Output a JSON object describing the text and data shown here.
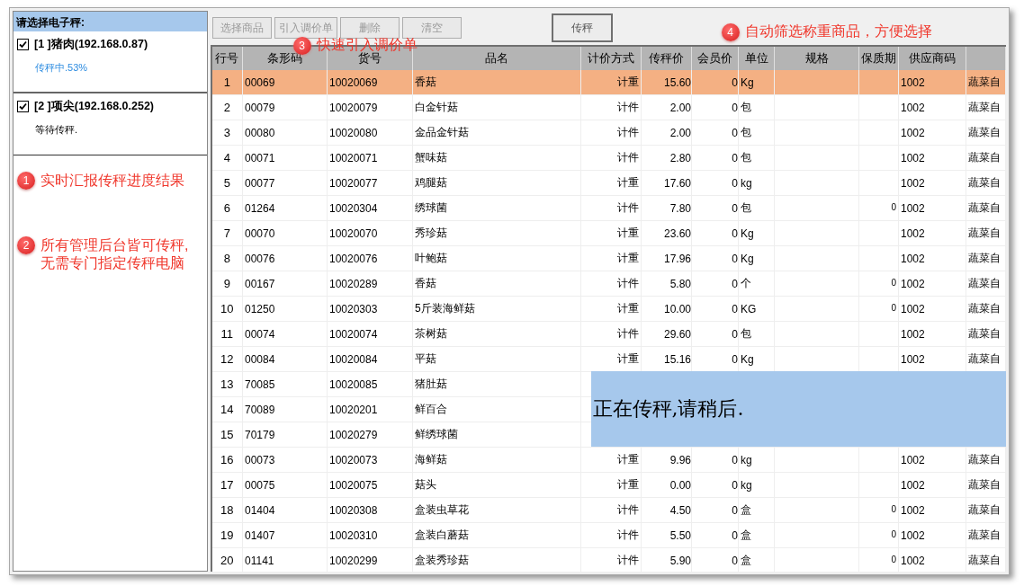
{
  "scale_panel": {
    "title": "请选择电子秤:",
    "scales": [
      {
        "label": "[1 ]猪肉(192.168.0.87)",
        "checked": true,
        "status": "传秤中.53%",
        "kind": "progress"
      },
      {
        "label": "[2 ]项尖(192.168.0.252)",
        "checked": true,
        "status": "等待传秤.",
        "kind": "waiting"
      }
    ]
  },
  "notes": [
    {
      "number": "1",
      "text": "实时汇报传秤进度结果"
    },
    {
      "number": "2",
      "text": "所有管理后台皆可传秤,\n无需专门指定传秤电脑"
    }
  ],
  "toolbar": {
    "buttons": [
      {
        "label": "选择商品",
        "disabled": true
      },
      {
        "label": "引入调价单",
        "disabled": true
      },
      {
        "label": "删除",
        "disabled": true
      },
      {
        "label": "清空",
        "disabled": true
      }
    ],
    "send_button": {
      "label": "传秤",
      "disabled": false
    }
  },
  "callouts": [
    {
      "number": "3",
      "text": "快速引入调价单"
    },
    {
      "number": "4",
      "text": "自动筛选称重商品，方便选择"
    }
  ],
  "table": {
    "columns": [
      "行号",
      "条形码",
      "货号",
      "品名",
      "计价方式",
      "传秤价",
      "会员价",
      "单位",
      "规格",
      "保质期",
      "供应商码"
    ],
    "rows": [
      {
        "no": "1",
        "barcode": "00069",
        "code": "10020069",
        "name": "香菇",
        "pricing": "计重",
        "price": "15.60",
        "member_price": "0",
        "unit": "Kg",
        "shelf_life": "",
        "supplier": "1002",
        "column_12": "蔬菜自",
        "selected": true
      },
      {
        "no": "2",
        "barcode": "00079",
        "code": "10020079",
        "name": "白金针菇",
        "pricing": "计件",
        "price": "2.00",
        "member_price": "0",
        "unit": "包",
        "supplier": "1002",
        "column_12": "蔬菜自",
        "selected": false
      },
      {
        "no": "3",
        "barcode": "00080",
        "code": "10020080",
        "name": "金品金针菇",
        "pricing": "计件",
        "price": "2.00",
        "member_price": "0",
        "unit": "包",
        "supplier": "1002",
        "column_12": "蔬菜自",
        "selected": false
      },
      {
        "no": "4",
        "barcode": "00071",
        "code": "10020071",
        "name": "蟹味菇",
        "pricing": "计件",
        "price": "2.80",
        "member_price": "0",
        "unit": "包",
        "supplier": "1002",
        "column_12": "蔬菜自",
        "selected": false
      },
      {
        "no": "5",
        "barcode": "00077",
        "code": "10020077",
        "name": "鸡腿菇",
        "pricing": "计重",
        "price": "17.60",
        "member_price": "0",
        "unit": "kg",
        "supplier": "1002",
        "column_12": "蔬菜自",
        "selected": false
      },
      {
        "no": "6",
        "barcode": "01264",
        "code": "10020304",
        "name": "绣球菌",
        "pricing": "计件",
        "price": "7.80",
        "member_price": "0",
        "unit": "包",
        "shelf_life": "0",
        "supplier": "1002",
        "column_12": "蔬菜自",
        "selected": false
      },
      {
        "no": "7",
        "barcode": "00070",
        "code": "10020070",
        "name": "秀珍菇",
        "pricing": "计重",
        "price": "23.60",
        "member_price": "0",
        "unit": "Kg",
        "supplier": "1002",
        "column_12": "蔬菜自",
        "selected": false
      },
      {
        "no": "8",
        "barcode": "00076",
        "code": "10020076",
        "name": "叶鲍菇",
        "pricing": "计重",
        "price": "17.96",
        "member_price": "0",
        "unit": "Kg",
        "supplier": "1002",
        "column_12": "蔬菜自",
        "selected": false
      },
      {
        "no": "9",
        "barcode": "00167",
        "code": "10020289",
        "name": "香菇",
        "pricing": "计件",
        "price": "5.80",
        "member_price": "0",
        "unit": "个",
        "shelf_life": "0",
        "supplier": "1002",
        "column_12": "蔬菜自",
        "selected": false
      },
      {
        "no": "10",
        "barcode": "01250",
        "code": "10020303",
        "name": "5斤装海鲜菇",
        "pricing": "计重",
        "price": "10.00",
        "member_price": "0",
        "unit": "KG",
        "shelf_life": "0",
        "supplier": "1002",
        "column_12": "蔬菜自",
        "selected": false
      },
      {
        "no": "11",
        "barcode": "00074",
        "code": "10020074",
        "name": "茶树菇",
        "pricing": "计件",
        "price": "29.60",
        "member_price": "0",
        "unit": "包",
        "supplier": "1002",
        "column_12": "蔬菜自",
        "selected": false
      },
      {
        "no": "12",
        "barcode": "00084",
        "code": "10020084",
        "name": "平菇",
        "pricing": "计重",
        "price": "15.16",
        "member_price": "0",
        "unit": "Kg",
        "supplier": "1002",
        "column_12": "蔬菜自",
        "selected": false
      },
      {
        "no": "13",
        "barcode": "70085",
        "code": "10020085",
        "name": "猪肚菇",
        "selected": false
      },
      {
        "no": "14",
        "barcode": "70089",
        "code": "10020201",
        "name": "鲜百合",
        "selected": false
      },
      {
        "no": "15",
        "barcode": "70179",
        "code": "10020279",
        "name": "鲜绣球菌",
        "selected": false
      },
      {
        "no": "16",
        "barcode": "00073",
        "code": "10020073",
        "name": "海鲜菇",
        "pricing": "计重",
        "price": "9.96",
        "member_price": "0",
        "unit": "kg",
        "supplier": "1002",
        "column_12": "蔬菜自",
        "selected": false
      },
      {
        "no": "17",
        "barcode": "00075",
        "code": "10020075",
        "name": "菇头",
        "pricing": "计重",
        "price": "0.00",
        "member_price": "0",
        "unit": "kg",
        "supplier": "1002",
        "column_12": "蔬菜自",
        "selected": false
      },
      {
        "no": "18",
        "barcode": "01404",
        "code": "10020308",
        "name": "盒装虫草花",
        "pricing": "计件",
        "price": "4.50",
        "member_price": "0",
        "unit": "盒",
        "shelf_life": "0",
        "supplier": "1002",
        "column_12": "蔬菜自",
        "selected": false
      },
      {
        "no": "19",
        "barcode": "01407",
        "code": "10020310",
        "name": "盒装白蘑菇",
        "pricing": "计件",
        "price": "5.50",
        "member_price": "0",
        "unit": "盒",
        "shelf_life": "0",
        "supplier": "1002",
        "column_12": "蔬菜自",
        "selected": false
      },
      {
        "no": "20",
        "barcode": "01141",
        "code": "10020299",
        "name": "盒装秀珍菇",
        "pricing": "计件",
        "price": "5.90",
        "member_price": "0",
        "unit": "盒",
        "shelf_life": "0",
        "supplier": "1002",
        "column_12": "蔬菜自",
        "selected": false
      }
    ]
  },
  "busy_overlay": {
    "message": "正在传秤,请稍后."
  }
}
